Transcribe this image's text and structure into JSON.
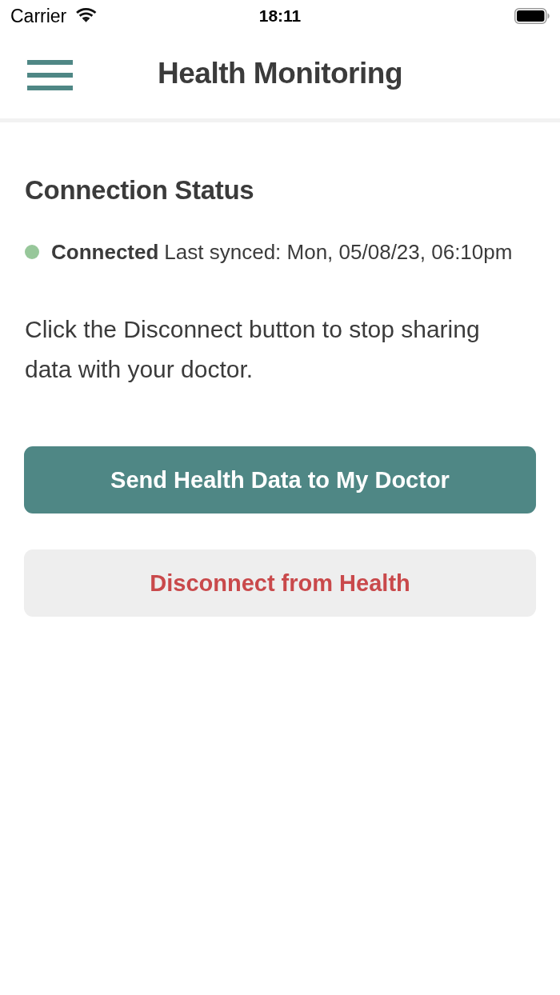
{
  "status_bar": {
    "carrier": "Carrier",
    "time": "18:11"
  },
  "nav": {
    "title": "Health Monitoring"
  },
  "connection": {
    "heading": "Connection Status",
    "status": {
      "label": "Connected",
      "color": "#97c79a"
    },
    "last_synced": "Last synced: Mon, 05/08/23, 06:10pm",
    "description": "Click the Disconnect button to stop sharing data with your doctor."
  },
  "buttons": [
    {
      "label": "Send Health Data to My Doctor",
      "kind": "primary"
    },
    {
      "label": "Disconnect from Health",
      "kind": "secondary"
    }
  ]
}
